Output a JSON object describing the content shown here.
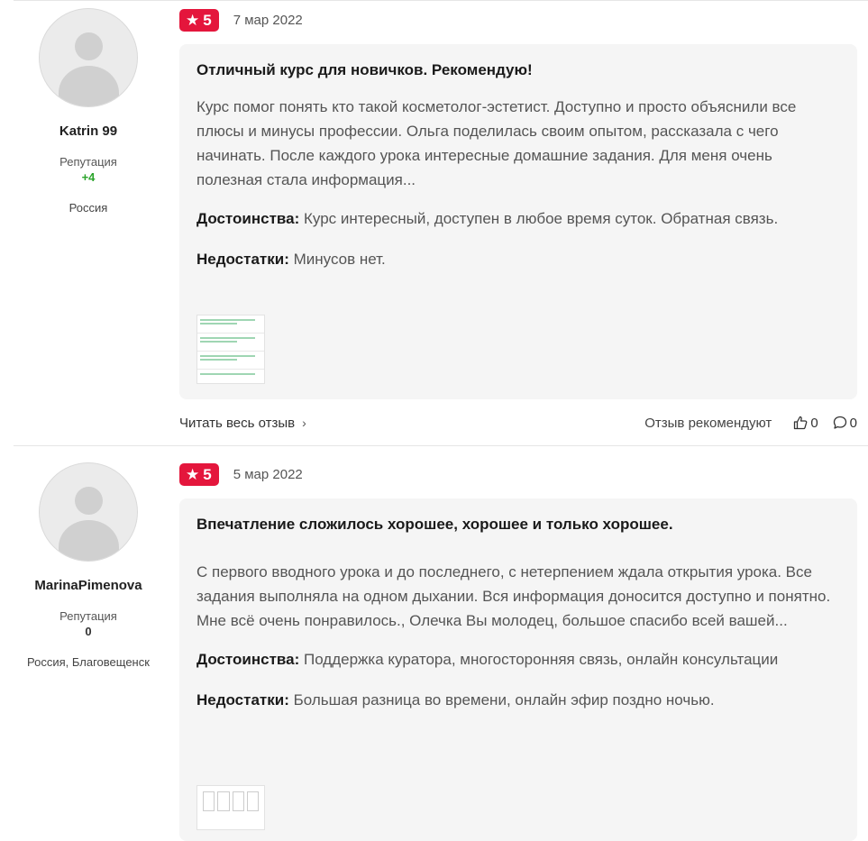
{
  "reviews": [
    {
      "author": {
        "name": "Katrin 99",
        "rep_label": "Репутация",
        "rep_value": "+4",
        "location": "Россия"
      },
      "rating": "5",
      "date": "7 мар 2022",
      "title": "Отличный курс для новичков. Рекомендую!",
      "text": "Курс помог понять кто такой косметолог-эстетист. Доступно и просто объяснили все плюсы и минусы профессии. Ольга поделилась своим опытом, рассказала с чего начинать. После каждого урока интересные домашние задания. Для меня очень полезная стала информация...",
      "pros_label": "Достоинства:",
      "pros": "Курс интересный, доступен в любое время суток. Обратная связь.",
      "cons_label": "Недостатки:",
      "cons": "Минусов нет.",
      "read_more": "Читать весь отзыв",
      "recommend_label": "Отзыв рекомендуют",
      "likes": "0",
      "comments": "0"
    },
    {
      "author": {
        "name": "MarinaPimenova",
        "rep_label": "Репутация",
        "rep_value": "0",
        "location": "Россия, Благовещенск"
      },
      "rating": "5",
      "date": "5 мар 2022",
      "title": "Впечатление сложилось хорошее, хорошее и только хорошее.",
      "text": "С первого вводного урока и до последнего, с нетерпением ждала открытия урока. Все задания выполняла на одном дыхании. Вся информация доносится доступно и понятно. Мне всё очень понравилось., Олечка Вы молодец, большое спасибо всей вашей...",
      "pros_label": "Достоинства:",
      "pros": "Поддержка куратора, многосторонняя связь, онлайн консультации",
      "cons_label": "Недостатки:",
      "cons": "Большая разница во времени, онлайн эфир поздно ночью."
    }
  ],
  "colors": {
    "rating_bg": "#e4163c",
    "rep_positive": "#2aa42a",
    "card_bg": "#f5f5f5"
  },
  "icons": [
    "star-icon",
    "chevron-right-icon",
    "thumbs-up-icon",
    "comment-icon",
    "avatar-placeholder-icon"
  ]
}
